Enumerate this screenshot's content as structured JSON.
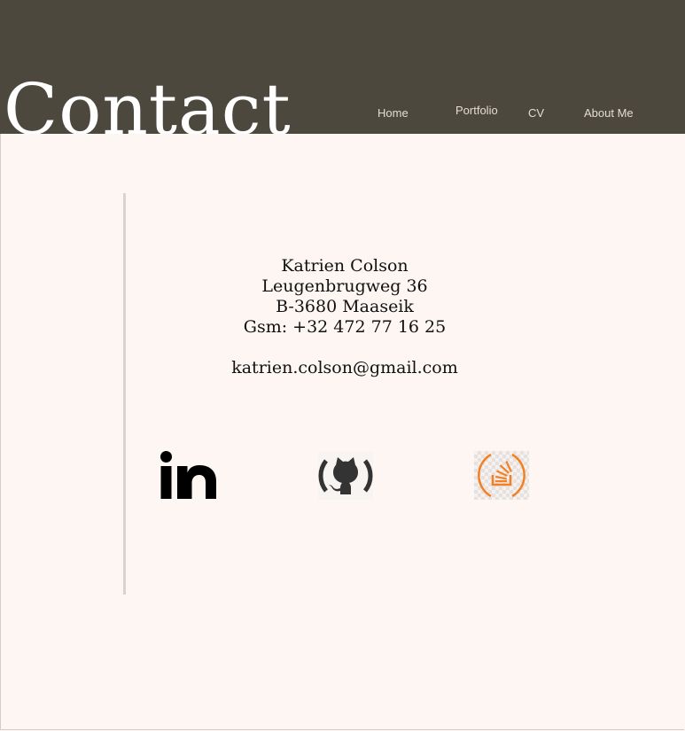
{
  "header": {
    "title": "Contact",
    "nav": [
      {
        "label": "Home"
      },
      {
        "label": "Portfolio"
      },
      {
        "label": "CV"
      },
      {
        "label": "About Me"
      }
    ]
  },
  "contact": {
    "name": "Katrien Colson",
    "street": "Leugenbrugweg 36",
    "city": "B-3680 Maaseik",
    "phone": "Gsm: +32 472 77 16 25",
    "email": "katrien.colson@gmail.com"
  },
  "social": [
    {
      "icon": "linkedin-icon"
    },
    {
      "icon": "github-icon"
    },
    {
      "icon": "stackoverflow-icon"
    }
  ],
  "colors": {
    "header_bg": "#4c483d",
    "page_bg": "#fdf6f3",
    "nav_text": "#e3ddd3",
    "stackoverflow_orange": "#f48024",
    "github_gray": "#333333"
  }
}
